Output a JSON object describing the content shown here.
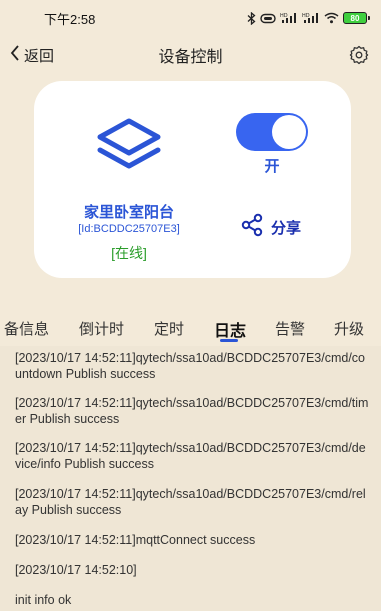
{
  "status_bar": {
    "time": "下午2:58",
    "battery": "80"
  },
  "header": {
    "back_label": "返回",
    "title": "设备控制"
  },
  "device": {
    "name": "家里卧室阳台",
    "id": "[Id:BCDDC25707E3]",
    "status": "[在线]",
    "switch_state": "开",
    "switch_on": true,
    "share_label": "分享"
  },
  "tabs": [
    {
      "label": "备信息"
    },
    {
      "label": "倒计时"
    },
    {
      "label": "定时"
    },
    {
      "label": "日志"
    },
    {
      "label": "告警"
    },
    {
      "label": "升级"
    }
  ],
  "active_tab": "日志",
  "logs": [
    "[2023/10/17 14:52:11]qytech/ssa10ad/BCDDC25707E3/cmd/countdown Publish success",
    "[2023/10/17 14:52:11]qytech/ssa10ad/BCDDC25707E3/cmd/timer Publish success",
    "[2023/10/17 14:52:11]qytech/ssa10ad/BCDDC25707E3/cmd/device/info Publish success",
    "[2023/10/17 14:52:11]qytech/ssa10ad/BCDDC25707E3/cmd/relay Publish success",
    "[2023/10/17 14:52:11]mqttConnect success",
    "[2023/10/17 14:52:10]",
    "init info ok"
  ],
  "colors": {
    "accent": "#2b55d6",
    "online": "#2a9d2a",
    "background": "#f3ead9"
  }
}
